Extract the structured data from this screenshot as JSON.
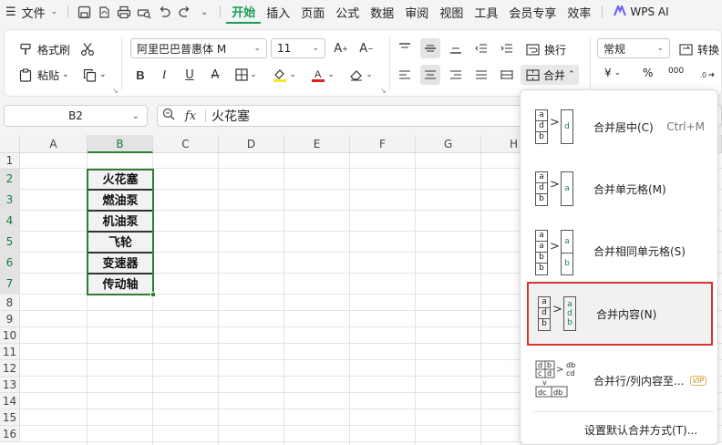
{
  "menubar": {
    "file": "文件",
    "tabs": [
      "开始",
      "插入",
      "页面",
      "公式",
      "数据",
      "审阅",
      "视图",
      "工具",
      "会员专享",
      "效率"
    ],
    "wps_ai": "WPS AI"
  },
  "ribbon": {
    "format_painter": "格式刷",
    "paste": "粘贴",
    "font_name": "阿里巴巴普惠体 M",
    "font_size": "11",
    "wrap": "换行",
    "merge": "合并",
    "number_format": "常规",
    "convert": "转换",
    "currency": "¥",
    "percent": "%",
    "thousands": "000"
  },
  "formula": {
    "cell_ref": "B2",
    "fx": "fx",
    "value": "火花塞"
  },
  "grid": {
    "columns": [
      "A",
      "B",
      "C",
      "D",
      "E",
      "F",
      "G",
      "H"
    ],
    "rows": [
      "1",
      "2",
      "3",
      "4",
      "5",
      "6",
      "7",
      "8",
      "9",
      "10",
      "11",
      "12",
      "13",
      "14",
      "15",
      "16"
    ],
    "b_cells": [
      "火花塞",
      "燃油泵",
      "机油泵",
      "飞轮",
      "变速器",
      "传动轴"
    ]
  },
  "merge_menu": {
    "items": [
      {
        "label": "合并居中(C)",
        "shortcut": "Ctrl+M"
      },
      {
        "label": "合并单元格(M)",
        "shortcut": ""
      },
      {
        "label": "合并相同单元格(S)",
        "shortcut": ""
      },
      {
        "label": "合并内容(N)",
        "shortcut": ""
      },
      {
        "label": "合并行/列内容至...",
        "shortcut": "",
        "badge": "VIP"
      }
    ],
    "default": "设置默认合并方式(T)...",
    "icon_letters": {
      "a": "a",
      "b": "b",
      "c": "c",
      "d": "d",
      "ab": "ab",
      "cd": "cd",
      "db": "db"
    }
  }
}
